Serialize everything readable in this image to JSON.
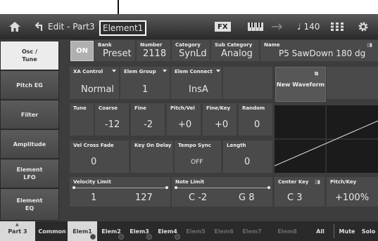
{
  "topbar": {
    "edit_title": "Edit - Part3",
    "element_label": "Element1",
    "fx_label": "FX",
    "tempo": "♩ 140"
  },
  "sidebar": {
    "items": [
      {
        "label": "Osc /\nTune",
        "active": true
      },
      {
        "label": "Pitch EG"
      },
      {
        "label": "Filter"
      },
      {
        "label": "Amplitude"
      },
      {
        "label": "Element\nLFO"
      },
      {
        "label": "Element\nEQ"
      }
    ]
  },
  "osc": {
    "on_label": "ON",
    "bank_label": "Bank",
    "bank_value": "Preset",
    "number_label": "Number",
    "number_value": "2118",
    "category_label": "Category",
    "category_value": "SynLd",
    "sub_category_label": "Sub Category",
    "sub_category_value": "Analog",
    "name_label": "Name",
    "name_value": "P5 SawDown 180 dg",
    "xa_control_label": "XA Control",
    "xa_control_value": "Normal",
    "elem_group_label": "Elem Group",
    "elem_group_value": "1",
    "elem_connect_label": "Elem Connect",
    "elem_connect_value": "InsA",
    "new_waveform_label": "New Waveform",
    "tune_label": "Tune",
    "coarse_label": "Coarse",
    "coarse_value": "-12",
    "fine_label": "Fine",
    "fine_value": "-2",
    "pitch_vel_label": "Pitch/Vel",
    "pitch_vel_value": "+0",
    "fine_key_label": "Fine/Key",
    "fine_key_value": "+0",
    "random_label": "Random",
    "random_value": "0",
    "vel_cross_fade_label": "Vel Cross Fade",
    "vel_cross_fade_value": "0",
    "key_on_delay_label": "Key On Delay",
    "tempo_sync_label": "Tempo Sync",
    "tempo_sync_value": "OFF",
    "length_label": "Length",
    "length_value": "0",
    "velocity_limit_label": "Velocity Limit",
    "velocity_limit_low": "1",
    "velocity_limit_high": "127",
    "note_limit_label": "Note Limit",
    "note_limit_low": "C -2",
    "note_limit_high": "G 8",
    "center_key_label": "Center Key",
    "center_key_value": "C 3",
    "pitch_key_label": "Pitch/Key",
    "pitch_key_value": "+100%"
  },
  "bottombar": {
    "part": "Part 3",
    "common": "Common",
    "elements": [
      "Elem1",
      "Elem2",
      "Elem3",
      "Elem4",
      "Elem5",
      "Elem6",
      "Elem7",
      "Elem8"
    ],
    "all": "All",
    "mute": "Mute",
    "solo": "Solo"
  }
}
